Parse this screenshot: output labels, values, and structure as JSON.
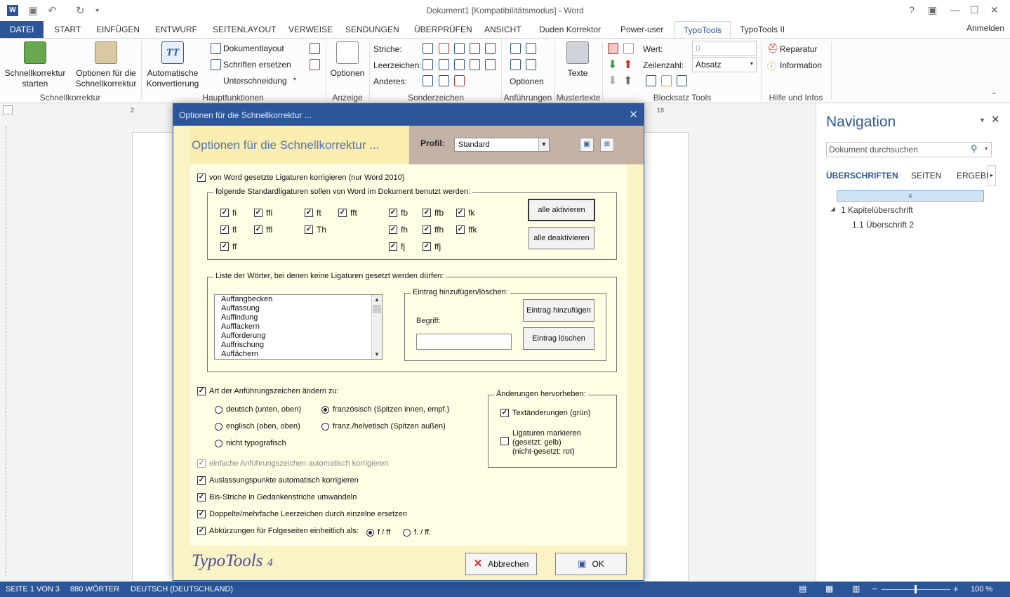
{
  "window": {
    "title": "Dokument1 [Kompatibilitätsmodus] - Word",
    "word_logo": "W",
    "signin": "Anmelden",
    "controls": [
      "?",
      "▣",
      "—",
      "☐",
      "✕"
    ]
  },
  "tabs": {
    "file": "DATEI",
    "start": "START",
    "insert": "EINFÜGEN",
    "design": "ENTWURF",
    "layout": "SEITENLAYOUT",
    "references": "VERWEISE",
    "mailings": "SENDUNGEN",
    "review": "ÜBERPRÜFEN",
    "view": "ANSICHT",
    "duden": "Duden Korrektor",
    "poweruser": "Power-user",
    "typotools": "TypoTools",
    "typotools2": "TypoTools II"
  },
  "ribbon": {
    "btn_quick_start": "Schnellkorrektur starten",
    "btn_quick_options": "Optionen für die Schnellkorrektur",
    "grp_quick": "Schnellkorrektur",
    "btn_auto_convert": "Automatische Konvertierung",
    "doc_layout": "Dokumentlayout",
    "replace_fonts": "Schriften ersetzen",
    "kerning": "Unterschneidung",
    "grp_main": "Hauptfunktionen",
    "btn_options": "Optionen",
    "grp_display": "Anzeige",
    "dashes": "Striche:",
    "spaces": "Leerzeichen:",
    "other": "Anderes:",
    "grp_special": "Sonderzeichen",
    "btn_quote_options": "Optionen",
    "grp_quotes": "Anführungen",
    "btn_texts": "Texte",
    "grp_templates": "Mustertexte",
    "value_label": "Wert:",
    "value": "0",
    "linecount_label": "Zeilenzahl:",
    "linecount": "Absatz",
    "grp_block": "Blocksatz Tools",
    "repair": "Reparatur",
    "info": "Information",
    "grp_help": "Hilfe und Infos"
  },
  "ruler": {
    "left": "2",
    "right": "18"
  },
  "navigation": {
    "title": "Navigation",
    "search_placeholder": "Dokument durchsuchen",
    "tab_headings": "ÜBERSCHRIFTEN",
    "tab_pages": "SEITEN",
    "tab_results": "ERGEBN",
    "item1": "1 Kapitelüberschrift",
    "item2": "1.1 Überschrift 2"
  },
  "status": {
    "page": "SEITE 1 VON 3",
    "words": "880 WÖRTER",
    "lang": "DEUTSCH (DEUTSCHLAND)",
    "zoom": "100 %"
  },
  "dialog": {
    "window_title": "Optionen für die Schnellkorrektur ...",
    "header_title": "Optionen für die Schnellkorrektur ...",
    "profile_label": "Profil:",
    "profile_value": "Standard",
    "cb_fix_ligatures": "von Word gesetzte Ligaturen korrigieren (nur Word 2010)",
    "group_std_ligatures": "folgende Standardligaturen sollen von Word im Dokument benutzt werden:",
    "ligatures": {
      "fi": "fi",
      "fl": "fl",
      "ff": "ff",
      "ffi": "ffi",
      "ffl": "ffl",
      "ft": "ft",
      "th": "Th",
      "fft": "fft",
      "fb": "fb",
      "fh": "fh",
      "fj": "fj",
      "ffb": "ffb",
      "ffh": "ffh",
      "ffj": "ffj",
      "fk": "fk",
      "ffk": "ffk"
    },
    "btn_activate_all": "alle aktivieren",
    "btn_deactivate_all": "alle deaktivieren",
    "group_word_list": "Liste der Wörter, bei denen keine Ligaturen gesetzt werden dürfen:",
    "words": [
      "Auffangbecken",
      "Auffassung",
      "Auffindung",
      "Aufflackern",
      "Aufforderung",
      "Auffrischung",
      "Auffächern"
    ],
    "group_entry": "Eintrag hinzufügen/löschen:",
    "term_label": "Begriff:",
    "btn_add_entry": "Eintrag hinzufügen",
    "btn_delete_entry": "Eintrag löschen",
    "cb_quote_style": "Art der Anführungszeichen ändern zu:",
    "rb_german": "deutsch (unten, oben)",
    "rb_french": "französisch (Spitzen innen, empf.)",
    "rb_english": "englisch (oben, oben)",
    "rb_swiss": "franz./helvetisch (Spitzen außen)",
    "rb_none": "nicht typografisch",
    "group_highlight": "Änderungen hervorheben:",
    "cb_text_changes": "Textänderungen (grün)",
    "cb_mark_ligatures_1": "Ligaturen markieren",
    "cb_mark_ligatures_2": "(gesetzt: gelb)",
    "cb_mark_ligatures_3": "(nicht-gesetzt: rot)",
    "cb_single_quotes": "einfache Anführungszeichen automatisch korrigieren",
    "cb_ellipsis": "Auslassungspunkte automatisch korrigieren",
    "cb_dashes": "Bis-Striche in Gedankenstriche umwandeln",
    "cb_spaces": "Doppelte/mehrfache Leerzeichen durch einzelne ersetzen",
    "cb_abbrev": "Abkürzungen für Folgeseiten einheitlich als:",
    "rb_ff": "f / ff",
    "rb_ff_dots": "f. / ff.",
    "logo_text": "TypoTools",
    "logo_num": "4",
    "btn_cancel": "Abbrechen",
    "btn_ok": "OK",
    "checkmark": "✓"
  }
}
